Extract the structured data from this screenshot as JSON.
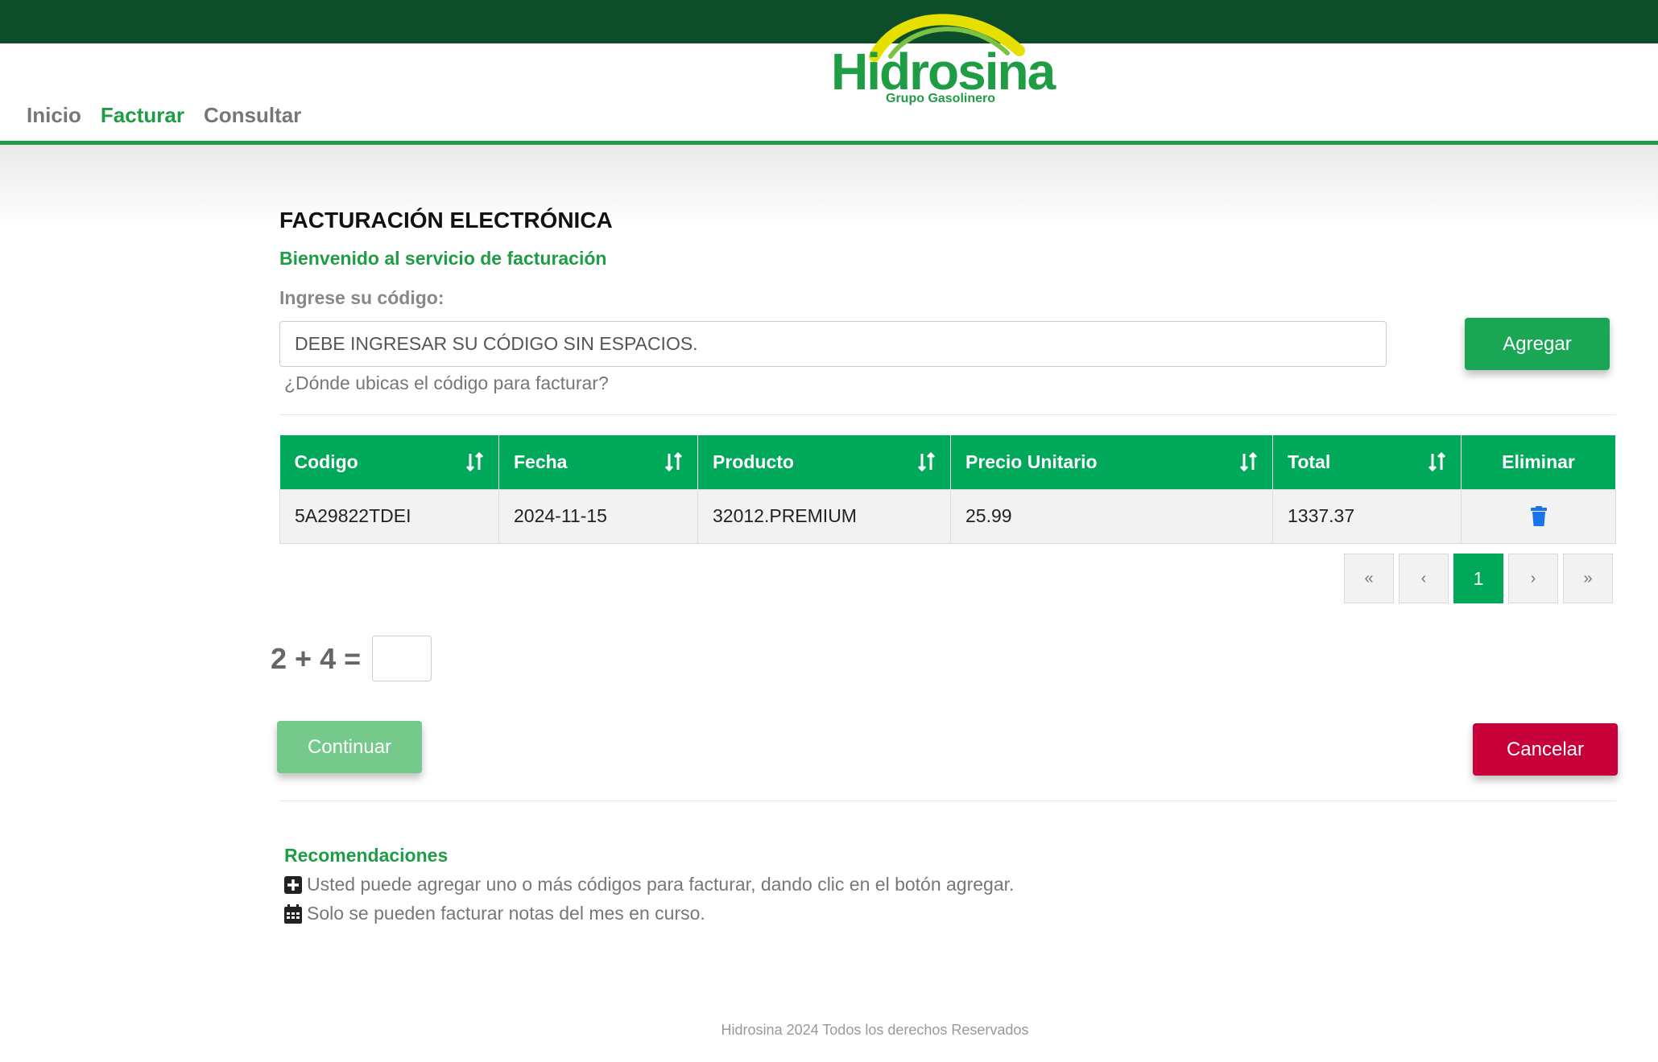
{
  "brand": {
    "name": "Hidrosina",
    "tagline": "Grupo Gasolinero",
    "colors": {
      "topbar": "#0d4d2a",
      "primary": "#1f9d45",
      "table_header": "#00a85a",
      "danger": "#c8003a"
    }
  },
  "nav": {
    "items": [
      {
        "label": "Inicio",
        "active": false
      },
      {
        "label": "Facturar",
        "active": true
      },
      {
        "label": "Consultar",
        "active": false
      }
    ]
  },
  "main": {
    "title": "FACTURACIÓN ELECTRÓNICA",
    "welcome": "Bienvenido al servicio de facturación",
    "code_label": "Ingrese su código:",
    "code_placeholder": "DEBE INGRESAR SU CÓDIGO SIN ESPACIOS.",
    "add_button": "Agregar",
    "help_link": "¿Dónde ubicas el código para facturar?"
  },
  "table": {
    "headers": [
      "Codigo",
      "Fecha",
      "Producto",
      "Precio Unitario",
      "Total",
      "Eliminar"
    ],
    "rows": [
      {
        "codigo": "5A29822TDEI",
        "fecha": "2024-11-15",
        "producto": "32012.PREMIUM",
        "precio": "25.99",
        "total": "1337.37",
        "delete_icon": "trash-icon"
      }
    ]
  },
  "pagination": {
    "first": "«",
    "prev": "‹",
    "current": "1",
    "next": "›",
    "last": "»"
  },
  "captcha": {
    "a": "2",
    "op": "+",
    "b": "4",
    "eq": "="
  },
  "actions": {
    "continue": "Continuar",
    "cancel": "Cancelar"
  },
  "recommendations": {
    "title": "Recomendaciones",
    "items": [
      {
        "icon": "plus-square-icon",
        "text": "Usted puede agregar uno o más códigos para facturar, dando clic en el botón agregar."
      },
      {
        "icon": "calendar-icon",
        "text": "Solo se pueden facturar notas del mes en curso."
      }
    ]
  },
  "footer": "Hidrosina 2024 Todos los derechos Reservados"
}
